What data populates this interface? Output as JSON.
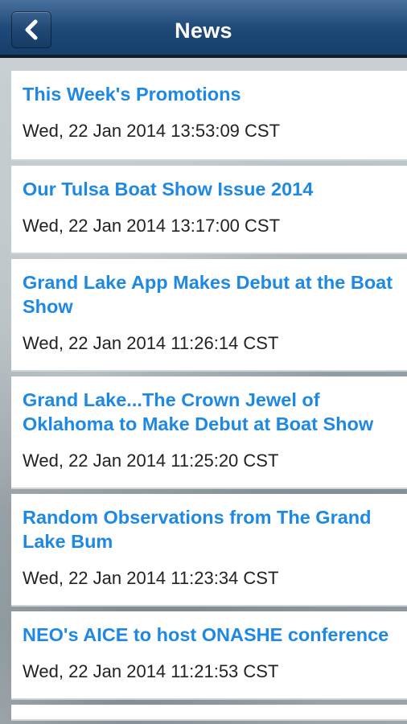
{
  "header": {
    "title": "News",
    "back_icon": "chevron-left-icon"
  },
  "news": {
    "items": [
      {
        "title": "This Week's Promotions",
        "date": "Wed, 22 Jan 2014 13:53:09 CST"
      },
      {
        "title": "Our Tulsa Boat Show Issue 2014",
        "date": "Wed, 22 Jan 2014 13:17:00 CST"
      },
      {
        "title": "Grand Lake App Makes Debut at the Boat Show",
        "date": "Wed, 22 Jan 2014 11:26:14 CST"
      },
      {
        "title": "Grand Lake...The Crown Jewel of Oklahoma to Make Debut at Boat Show",
        "date": "Wed, 22 Jan 2014 11:25:20 CST"
      },
      {
        "title": "Random Observations from The Grand Lake Bum",
        "date": "Wed, 22 Jan 2014 11:23:34 CST"
      },
      {
        "title": "NEO's AICE to host ONASHE conference",
        "date": "Wed, 22 Jan 2014 11:21:53 CST"
      }
    ]
  },
  "colors": {
    "header_bg": "#1f4a7a",
    "title_link": "#1e88e5",
    "date_text": "#222222"
  }
}
